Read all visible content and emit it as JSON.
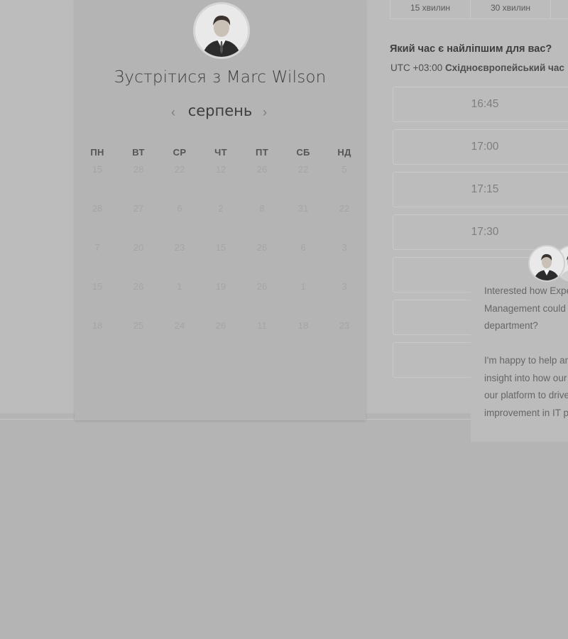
{
  "meeting": {
    "title": "Зустрітися з Marc Wilson",
    "month": "серпень",
    "prev_icon": "chevron-left-icon",
    "next_icon": "chevron-right-icon"
  },
  "calendar": {
    "weekdays": [
      "ПН",
      "ВТ",
      "СР",
      "ЧТ",
      "ПТ",
      "СБ",
      "НД"
    ],
    "rows": [
      [
        "15",
        "28",
        "22",
        "12",
        "26",
        "22",
        "5"
      ],
      [
        "28",
        "27",
        "6",
        "2",
        "8",
        "31",
        "22"
      ],
      [
        "7",
        "20",
        "23",
        "15",
        "26",
        "6",
        "3"
      ],
      [
        "15",
        "26",
        "1",
        "19",
        "26",
        "1",
        "3"
      ],
      [
        "18",
        "25",
        "24",
        "26",
        "11",
        "18",
        "23"
      ]
    ]
  },
  "durations": [
    "15 хвилин",
    "30 хвилин"
  ],
  "time_picker": {
    "question": "Який час є найліпшим для вас?",
    "tz_offset": "UTC +03:00",
    "tz_name": "Східноєвропейський час",
    "slots": [
      "16:45",
      "17:00",
      "17:15",
      "17:30",
      "",
      "",
      ""
    ]
  },
  "chat": {
    "paragraph1": "Interested how Expert Management could help your department?",
    "paragraph2": "I'm happy to help and give you insight into how our users use our platform to drive improvement in IT productivity."
  },
  "colors": {
    "background": "#b4b4b4",
    "card": "#b4b4b4",
    "text": "#3e3e3e"
  }
}
